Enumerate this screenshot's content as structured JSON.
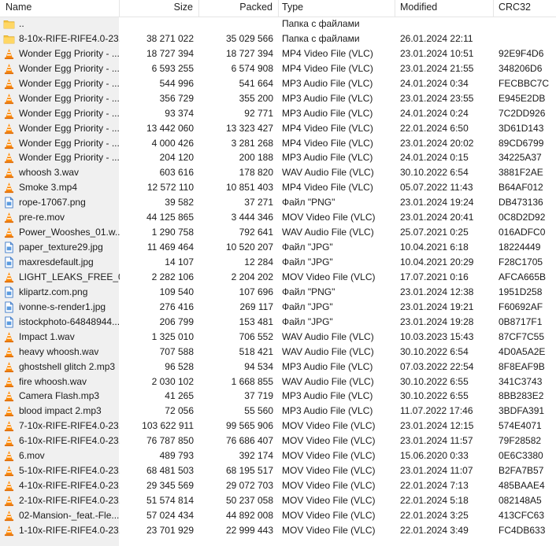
{
  "columns": {
    "name": "Name",
    "size": "Size",
    "packed": "Packed",
    "type": "Type",
    "modified": "Modified",
    "crc": "CRC32"
  },
  "rows": [
    {
      "icon": "folder-up-icon",
      "name": "..",
      "size": "",
      "packed": "",
      "type": "Папка с файлами",
      "modified": "",
      "crc": ""
    },
    {
      "icon": "folder-icon",
      "name": "8-10x-RIFE-RIFE4.0-23...",
      "size": "38 271 022",
      "packed": "35 029 566",
      "type": "Папка с файлами",
      "modified": "26.01.2024 22:11",
      "crc": ""
    },
    {
      "icon": "vlc-icon",
      "name": "Wonder Egg Priority - ...",
      "size": "18 727 394",
      "packed": "18 727 394",
      "type": "MP4 Video File (VLC)",
      "modified": "23.01.2024 10:51",
      "crc": "92E9F4D6"
    },
    {
      "icon": "vlc-icon",
      "name": "Wonder Egg Priority - ...",
      "size": "6 593 255",
      "packed": "6 574 908",
      "type": "MP4 Video File (VLC)",
      "modified": "23.01.2024 21:55",
      "crc": "348206D6"
    },
    {
      "icon": "vlc-icon",
      "name": "Wonder Egg Priority - ...",
      "size": "544 996",
      "packed": "541 664",
      "type": "MP3 Audio File (VLC)",
      "modified": "24.01.2024 0:34",
      "crc": "FECBBC7C"
    },
    {
      "icon": "vlc-icon",
      "name": "Wonder Egg Priority - ...",
      "size": "356 729",
      "packed": "355 200",
      "type": "MP3 Audio File (VLC)",
      "modified": "23.01.2024 23:55",
      "crc": "E945E2DB"
    },
    {
      "icon": "vlc-icon",
      "name": "Wonder Egg Priority - ...",
      "size": "93 374",
      "packed": "92 771",
      "type": "MP3 Audio File (VLC)",
      "modified": "24.01.2024 0:24",
      "crc": "7C2DD926"
    },
    {
      "icon": "vlc-icon",
      "name": "Wonder Egg Priority - ...",
      "size": "13 442 060",
      "packed": "13 323 427",
      "type": "MP4 Video File (VLC)",
      "modified": "22.01.2024 6:50",
      "crc": "3D61D143"
    },
    {
      "icon": "vlc-icon",
      "name": "Wonder Egg Priority - ...",
      "size": "4 000 426",
      "packed": "3 281 268",
      "type": "MP4 Video File (VLC)",
      "modified": "23.01.2024 20:02",
      "crc": "89CD6799"
    },
    {
      "icon": "vlc-icon",
      "name": "Wonder Egg Priority - ...",
      "size": "204 120",
      "packed": "200 188",
      "type": "MP3 Audio File (VLC)",
      "modified": "24.01.2024 0:15",
      "crc": "34225A37"
    },
    {
      "icon": "vlc-icon",
      "name": "whoosh 3.wav",
      "size": "603 616",
      "packed": "178 820",
      "type": "WAV Audio File (VLC)",
      "modified": "30.10.2022 6:54",
      "crc": "3881F2AE"
    },
    {
      "icon": "vlc-icon",
      "name": "Smoke 3.mp4",
      "size": "12 572 110",
      "packed": "10 851 403",
      "type": "MP4 Video File (VLC)",
      "modified": "05.07.2022 11:43",
      "crc": "B64AF012"
    },
    {
      "icon": "image-icon",
      "name": "rope-17067.png",
      "size": "39 582",
      "packed": "37 271",
      "type": "Файл \"PNG\"",
      "modified": "23.01.2024 19:24",
      "crc": "DB473136"
    },
    {
      "icon": "vlc-icon",
      "name": "pre-re.mov",
      "size": "44 125 865",
      "packed": "3 444 346",
      "type": "MOV Video File (VLC)",
      "modified": "23.01.2024 20:41",
      "crc": "0C8D2D92"
    },
    {
      "icon": "vlc-icon",
      "name": "Power_Wooshes_01.w...",
      "size": "1 290 758",
      "packed": "792 641",
      "type": "WAV Audio File (VLC)",
      "modified": "25.07.2021 0:25",
      "crc": "016ADFC0"
    },
    {
      "icon": "image-icon",
      "name": "paper_texture29.jpg",
      "size": "11 469 464",
      "packed": "10 520 207",
      "type": "Файл \"JPG\"",
      "modified": "10.04.2021 6:18",
      "crc": "18224449"
    },
    {
      "icon": "image-icon",
      "name": "maxresdefault.jpg",
      "size": "14 107",
      "packed": "12 284",
      "type": "Файл \"JPG\"",
      "modified": "10.04.2021 20:29",
      "crc": "F28C1705"
    },
    {
      "icon": "vlc-icon",
      "name": "LIGHT_LEAKS_FREE_02...",
      "size": "2 282 106",
      "packed": "2 204 202",
      "type": "MOV Video File (VLC)",
      "modified": "17.07.2021 0:16",
      "crc": "AFCA665B"
    },
    {
      "icon": "image-icon",
      "name": "klipartz.com.png",
      "size": "109 540",
      "packed": "107 696",
      "type": "Файл \"PNG\"",
      "modified": "23.01.2024 12:38",
      "crc": "1951D258"
    },
    {
      "icon": "image-icon",
      "name": "ivonne-s-render1.jpg",
      "size": "276 416",
      "packed": "269 117",
      "type": "Файл \"JPG\"",
      "modified": "23.01.2024 19:21",
      "crc": "F60692AF"
    },
    {
      "icon": "image-icon",
      "name": "istockphoto-64848944...",
      "size": "206 799",
      "packed": "153 481",
      "type": "Файл \"JPG\"",
      "modified": "23.01.2024 19:28",
      "crc": "0B8717F1"
    },
    {
      "icon": "vlc-icon",
      "name": "Impact 1.wav",
      "size": "1 325 010",
      "packed": "706 552",
      "type": "WAV Audio File (VLC)",
      "modified": "10.03.2023 15:43",
      "crc": "87CF7C55"
    },
    {
      "icon": "vlc-icon",
      "name": "heavy whoosh.wav",
      "size": "707 588",
      "packed": "518 421",
      "type": "WAV Audio File (VLC)",
      "modified": "30.10.2022 6:54",
      "crc": "4D0A5A2E"
    },
    {
      "icon": "vlc-icon",
      "name": "ghostshell glitch 2.mp3",
      "size": "96 528",
      "packed": "94 534",
      "type": "MP3 Audio File (VLC)",
      "modified": "07.03.2022 22:54",
      "crc": "8F8EAF9B"
    },
    {
      "icon": "vlc-icon",
      "name": "fire whoosh.wav",
      "size": "2 030 102",
      "packed": "1 668 855",
      "type": "WAV Audio File (VLC)",
      "modified": "30.10.2022 6:55",
      "crc": "341C3743"
    },
    {
      "icon": "vlc-icon",
      "name": "Camera Flash.mp3",
      "size": "41 265",
      "packed": "37 719",
      "type": "MP3 Audio File (VLC)",
      "modified": "30.10.2022 6:55",
      "crc": "8BB283E2"
    },
    {
      "icon": "vlc-icon",
      "name": "blood impact 2.mp3",
      "size": "72 056",
      "packed": "55 560",
      "type": "MP3 Audio File (VLC)",
      "modified": "11.07.2022 17:46",
      "crc": "3BDFA391"
    },
    {
      "icon": "vlc-icon",
      "name": "7-10x-RIFE-RIFE4.0-23...",
      "size": "103 622 911",
      "packed": "99 565 906",
      "type": "MOV Video File (VLC)",
      "modified": "23.01.2024 12:15",
      "crc": "574E4071"
    },
    {
      "icon": "vlc-icon",
      "name": "6-10x-RIFE-RIFE4.0-23...",
      "size": "76 787 850",
      "packed": "76 686 407",
      "type": "MOV Video File (VLC)",
      "modified": "23.01.2024 11:57",
      "crc": "79F28582"
    },
    {
      "icon": "vlc-icon",
      "name": "6.mov",
      "size": "489 793",
      "packed": "392 174",
      "type": "MOV Video File (VLC)",
      "modified": "15.06.2020 0:33",
      "crc": "0E6C3380"
    },
    {
      "icon": "vlc-icon",
      "name": "5-10x-RIFE-RIFE4.0-23...",
      "size": "68 481 503",
      "packed": "68 195 517",
      "type": "MOV Video File (VLC)",
      "modified": "23.01.2024 11:07",
      "crc": "B2FA7B57"
    },
    {
      "icon": "vlc-icon",
      "name": "4-10x-RIFE-RIFE4.0-23...",
      "size": "29 345 569",
      "packed": "29 072 703",
      "type": "MOV Video File (VLC)",
      "modified": "22.01.2024 7:13",
      "crc": "485BAAE4"
    },
    {
      "icon": "vlc-icon",
      "name": "2-10x-RIFE-RIFE4.0-23...",
      "size": "51 574 814",
      "packed": "50 237 058",
      "type": "MOV Video File (VLC)",
      "modified": "22.01.2024 5:18",
      "crc": "082148A5"
    },
    {
      "icon": "vlc-icon",
      "name": "02-Mansion-_feat.-Fle...",
      "size": "57 024 434",
      "packed": "44 892 008",
      "type": "MOV Video File (VLC)",
      "modified": "22.01.2024 3:25",
      "crc": "413CFC63"
    },
    {
      "icon": "vlc-icon",
      "name": "1-10x-RIFE-RIFE4.0-23...",
      "size": "23 701 929",
      "packed": "22 999 443",
      "type": "MOV Video File (VLC)",
      "modified": "22.01.2024 3:49",
      "crc": "FC4DB633"
    }
  ]
}
